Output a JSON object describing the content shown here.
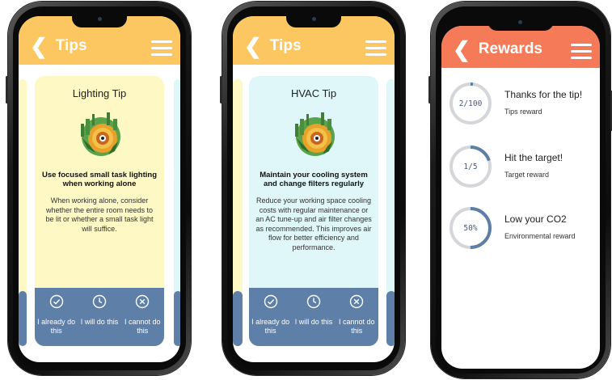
{
  "phone1": {
    "header_title": "Tips",
    "card_title": "Lighting Tip",
    "tip": "Use focused small task lighting when working alone",
    "body": "When working alone, consider whether the entire room needs to be lit or whether a small task light will suffice."
  },
  "phone2": {
    "header_title": "Tips",
    "card_title": "HVAC Tip",
    "tip": "Maintain your cooling system and change filters regularly",
    "body": "Reduce your working space cooling costs with regular maintenance or an AC tune-up and air filter changes as recommended. This improves air flow for better efficiency and performance."
  },
  "actions": {
    "already": "I already do this",
    "will": "I will do this",
    "cannot": "I cannot do this"
  },
  "phone3": {
    "header_title": "Rewards",
    "rewards": [
      {
        "progress_label": "2/100",
        "progress": 0.02,
        "title": "Thanks for the tip!",
        "subtitle": "Tips reward"
      },
      {
        "progress_label": "1/5",
        "progress": 0.2,
        "title": "Hit the target!",
        "subtitle": "Target reward"
      },
      {
        "progress_label": "50%",
        "progress": 0.5,
        "title": "Low your CO2",
        "subtitle": "Environmental reward"
      }
    ]
  },
  "colors": {
    "tips_header": "#fcc660",
    "rewards_header": "#f57a58",
    "lighting_card": "#fdf8c4",
    "hvac_card": "#dff7f8",
    "action_bar": "#5e7fa8",
    "ring_track": "#d4d6d9",
    "ring_fill": "#5f7ea6"
  },
  "icons": {
    "back": "chevron-left-icon",
    "menu": "hamburger-menu-icon",
    "already": "check-circle-icon",
    "will": "clock-icon",
    "cannot": "x-circle-icon",
    "tip_image": "city-sun-illustration"
  }
}
